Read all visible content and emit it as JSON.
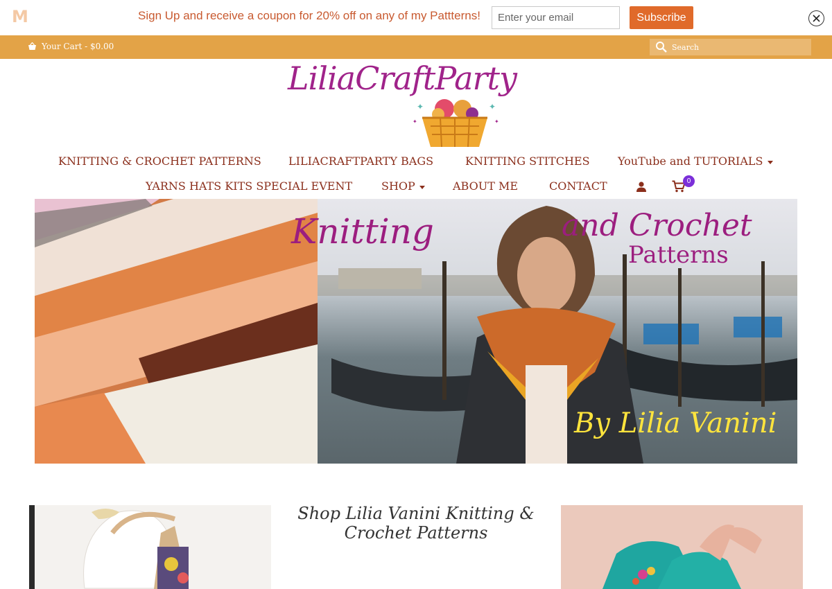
{
  "signup": {
    "logo_letter": "M",
    "message": "Sign Up and receive a coupon for 20% off on any of my Pattterns!",
    "email_placeholder": "Enter your email",
    "subscribe_label": "Subscribe"
  },
  "topbar": {
    "cart_label": "Your Cart - $0.00",
    "search_placeholder": "Search"
  },
  "logo": {
    "text": "LiliaCraftParty"
  },
  "nav": {
    "row1": [
      {
        "label": "KNITTING & CROCHET PATTERNS",
        "has_dropdown": false
      },
      {
        "label": "LILIACRAFTPARTY BAGS",
        "has_dropdown": false
      },
      {
        "label": "KNITTING STITCHES",
        "has_dropdown": false
      },
      {
        "label": "YouTube and TUTORIALS",
        "has_dropdown": true
      }
    ],
    "row2": [
      {
        "label": "YARNS HATS KITS SPECIAL EVENT",
        "has_dropdown": false
      },
      {
        "label": "SHOP",
        "has_dropdown": true
      },
      {
        "label": "ABOUT ME",
        "has_dropdown": false
      },
      {
        "label": "CONTACT",
        "has_dropdown": false
      }
    ],
    "cart_count": "0"
  },
  "hero": {
    "title_word1": "Knitting",
    "title_word2": "and Crochet",
    "title_word3": "Patterns",
    "signature": "By Lilia Vanini"
  },
  "shop": {
    "heading": "Shop Lilia Vanini Knitting & Crochet Patterns"
  },
  "colors": {
    "accent_orange": "#e3a347",
    "button_orange": "#e06a2a",
    "nav_text": "#8b2f1c",
    "brand_magenta": "#a0238a",
    "badge_purple": "#7b2fd9"
  }
}
